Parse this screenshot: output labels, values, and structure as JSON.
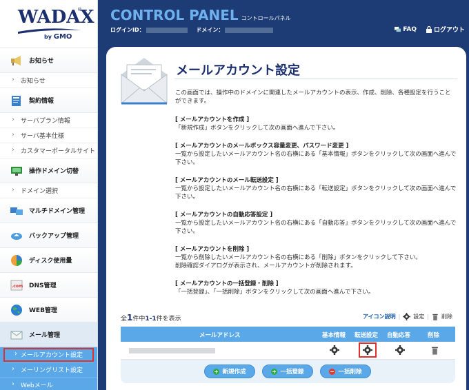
{
  "brand": {
    "logo": "WADAX",
    "sub": "by",
    "gmo": "GMO"
  },
  "header": {
    "title": "CONTROL PANEL",
    "title_sub": "コントロールパネル",
    "login_label": "ログインID：",
    "domain_label": "ドメイン：",
    "faq": "FAQ",
    "logout": "ログアウト"
  },
  "sidebar": {
    "news": {
      "head": "お知らせ",
      "subs": [
        "お知らせ"
      ]
    },
    "contract": {
      "head": "契約情報",
      "subs": [
        "サーバプラン情報",
        "サーバ基本仕様",
        "カスタマーポータルサイト"
      ]
    },
    "domain_switch": {
      "head": "操作ドメイン切替",
      "subs": [
        "ドメイン選択"
      ]
    },
    "multi_domain": {
      "head": "マルチドメイン管理"
    },
    "backup": {
      "head": "バックアップ管理"
    },
    "disk": {
      "head": "ディスク使用量"
    },
    "dns": {
      "head": "DNS管理"
    },
    "web": {
      "head": "WEB管理"
    },
    "mail": {
      "head": "メール管理",
      "subs": [
        "メールアカウント設定",
        "メーリングリスト設定",
        "Webメール"
      ]
    }
  },
  "main": {
    "title": "メールアカウント設定",
    "intro": "この画面では、操作中のドメインに関連したメールアカウントの表示、作成、削除、各種設定を行うことができます。",
    "sections": [
      {
        "head": "[ メールアカウントを作成 ]",
        "body": "「新規作成」ボタンをクリックして次の画面へ進んで下さい。"
      },
      {
        "head": "[ メールアカウントのメールボックス容量変更、パスワード変更 ]",
        "body": "一覧から設定したいメールアカウント名の右横にある「基本情報」ボタンをクリックして次の画面へ進んで下さい。"
      },
      {
        "head": "[ メールアカウントのメール転送設定 ]",
        "body": "一覧から設定したいメールアカウント名の右横にある「転送設定」ボタンをクリックして次の画面へ進んで下さい。"
      },
      {
        "head": "[ メールアカウントの自動応答設定 ]",
        "body": "一覧から設定したいメールアカウント名の右横にある「自動応答」ボタンをクリックして次の画面へ進んで下さい。"
      },
      {
        "head": "[ メールアカウントを削除 ]",
        "body": "一覧から削除したいメールアカウント名の右横にある「削除」ボタンをクリックして下さい。",
        "body2": "削除確認ダイアログが表示され、メールアカウントが削除されます。"
      },
      {
        "head": "[ メールアカウントの一括登録・削除 ]",
        "body": "「一括登録」、「一括削除」ボタンをクリックして次の画面へ進んで下さい。"
      }
    ],
    "count_prefix": "全",
    "count_total": "1",
    "count_mid": "件中",
    "count_range": "1-1",
    "count_suffix": "件を表示",
    "legend": {
      "link": "アイコン説明",
      "settings": "設定",
      "delete": "削除"
    },
    "table": {
      "headers": {
        "address": "メールアドレス",
        "basic": "基本情報",
        "forward": "転送設定",
        "auto": "自動応答",
        "delete": "削除"
      }
    },
    "buttons": {
      "new": "新規作成",
      "bulk_add": "一括登録",
      "bulk_delete": "一括削除"
    }
  },
  "colors": {
    "navy": "#1d3c75",
    "accent": "#5aa8e8",
    "highlight": "#e0302c"
  }
}
